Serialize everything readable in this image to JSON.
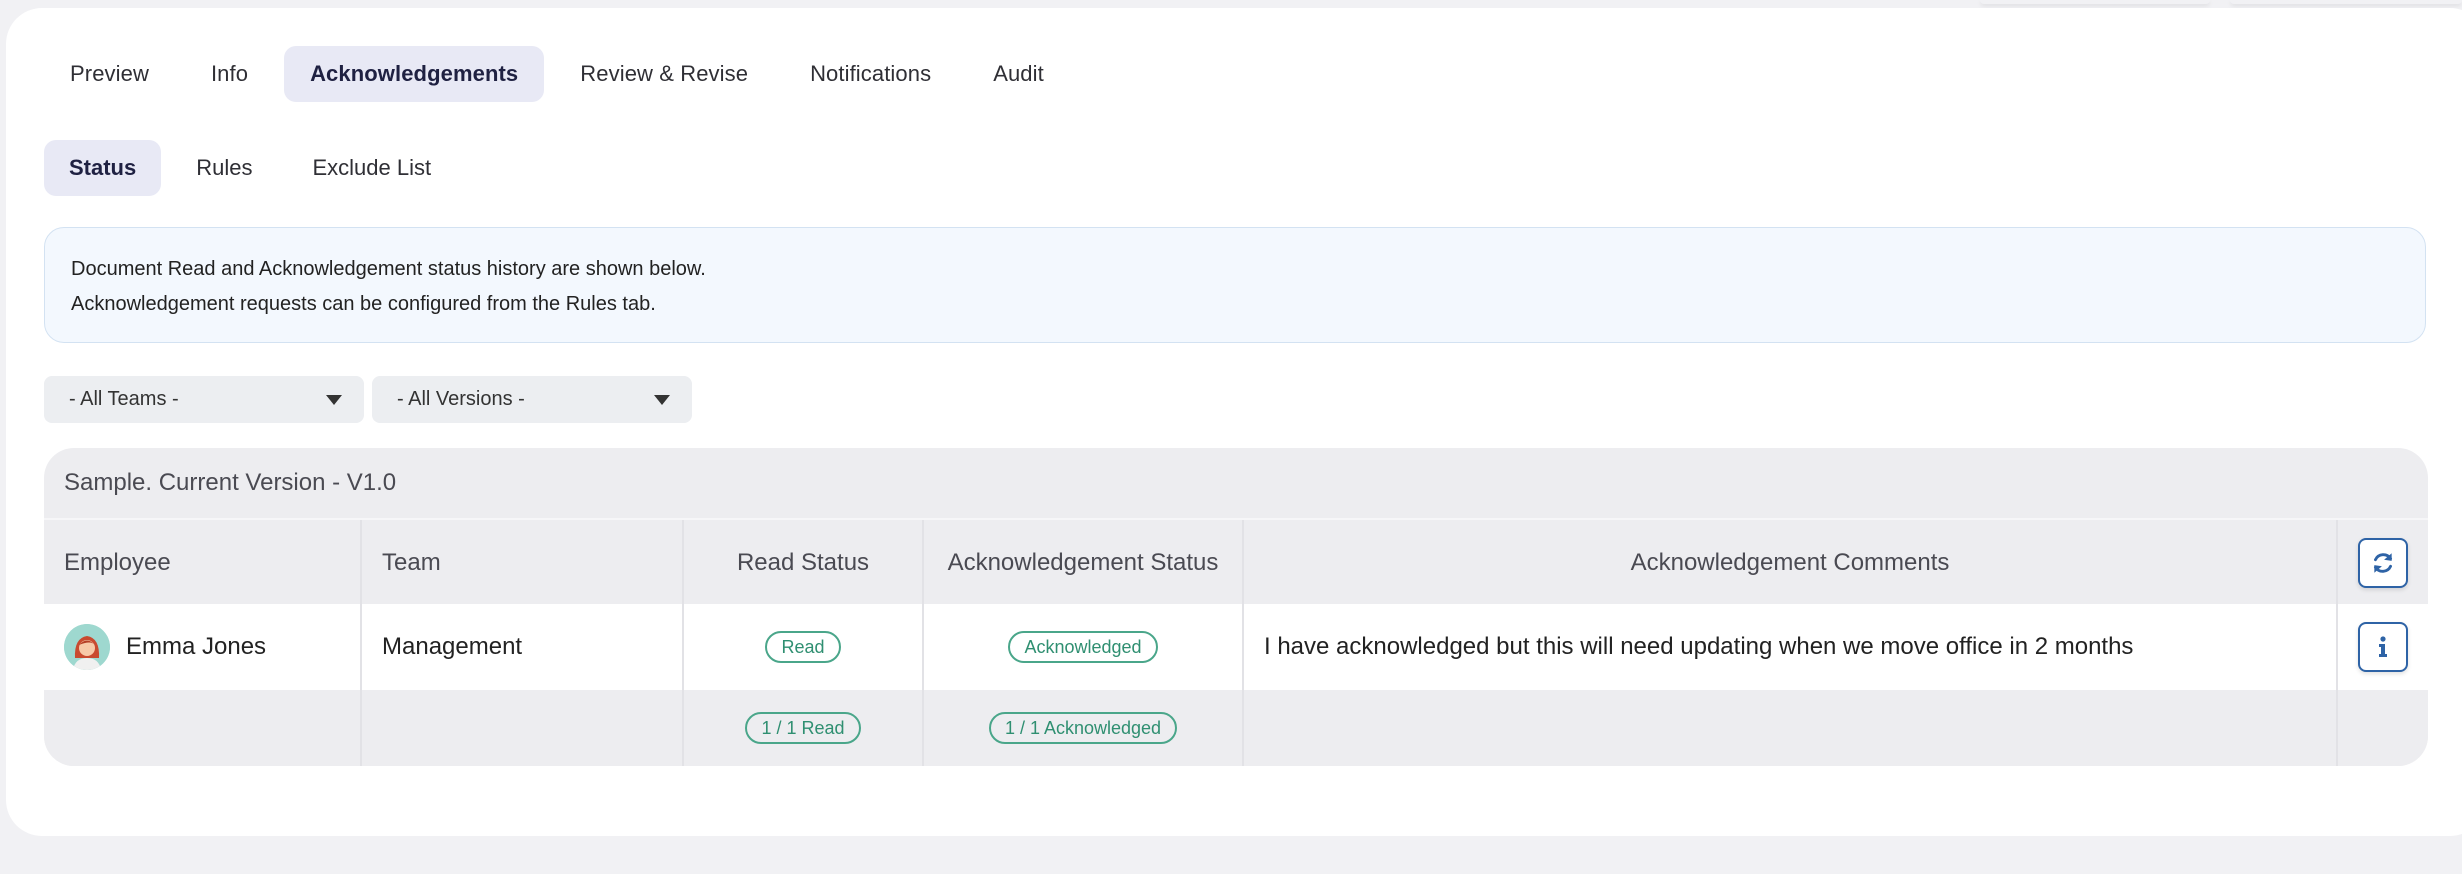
{
  "tabs": [
    "Preview",
    "Info",
    "Acknowledgements",
    "Review & Revise",
    "Notifications",
    "Audit"
  ],
  "active_tab": "Acknowledgements",
  "subtabs": [
    "Status",
    "Rules",
    "Exclude List"
  ],
  "active_subtab": "Status",
  "info": {
    "line1": "Document Read and Acknowledgement status history are shown below.",
    "line2": "Acknowledgement requests can be configured from the Rules tab."
  },
  "filters": {
    "teams": "- All Teams -",
    "versions": "- All Versions -"
  },
  "table": {
    "title": "Sample. Current Version - V1.0",
    "headers": {
      "employee": "Employee",
      "team": "Team",
      "read_status": "Read Status",
      "ack_status": "Acknowledgement Status",
      "ack_comments": "Acknowledgement Comments"
    },
    "rows": [
      {
        "employee": "Emma Jones",
        "team": "Management",
        "read_status": "Read",
        "ack_status": "Acknowledged",
        "comment": "I have acknowledged but this will need updating when we move office in 2 months"
      }
    ],
    "summary": {
      "read": "1 / 1 Read",
      "acknowledged": "1 / 1 Acknowledged"
    }
  },
  "icons": {
    "refresh": "refresh-icon",
    "info": "info-icon",
    "dropdown": "caret-down-icon"
  },
  "colors": {
    "accent": "#2e63a6",
    "status_green": "#4aa68a",
    "active_tab_bg": "#e8e9f5",
    "info_bg": "#f3f8fe"
  }
}
